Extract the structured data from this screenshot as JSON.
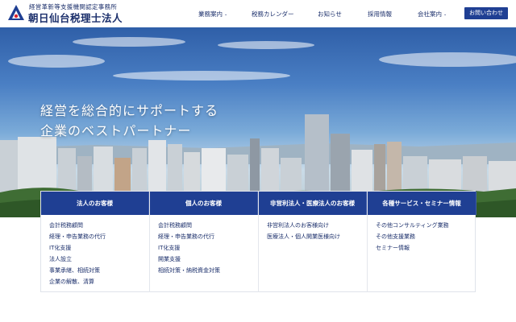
{
  "header": {
    "logo_sub": "経営革新等支援機関認定事務所",
    "logo_main": "朝日仙台税理士法人",
    "nav": [
      {
        "label": "業務案内",
        "has_dropdown": true
      },
      {
        "label": "税務カレンダー",
        "has_dropdown": false
      },
      {
        "label": "お知らせ",
        "has_dropdown": false
      },
      {
        "label": "採用情報",
        "has_dropdown": false
      },
      {
        "label": "会社案内",
        "has_dropdown": true
      }
    ],
    "contact_label": "お問い合わせ",
    "caret": "⌄",
    "brand_color": "#1f3f93"
  },
  "hero": {
    "line1": "経営を総合的にサポートする",
    "line2": "企業のベストパートナー"
  },
  "services": [
    {
      "title": "法人のお客様",
      "items": [
        "会計税務顧問",
        "経理・申告業務の代行",
        "IT化支援",
        "法人設立",
        "事業承継、相続対策",
        "企業の解散、清算"
      ]
    },
    {
      "title": "個人のお客様",
      "items": [
        "会計税務顧問",
        "経理・申告業務の代行",
        "IT化支援",
        "開業支援",
        "相続対策・納税資金対策"
      ]
    },
    {
      "title": "非営利法人・医療法人のお客様",
      "items": [
        "非営利法人のお客様向け",
        "医療法人・個人開業医様向け"
      ]
    },
    {
      "title": "各種サービス・セミナー情報",
      "items": [
        "その他コンサルティング業務",
        "その他支援業務",
        "セミナー情報"
      ]
    }
  ]
}
